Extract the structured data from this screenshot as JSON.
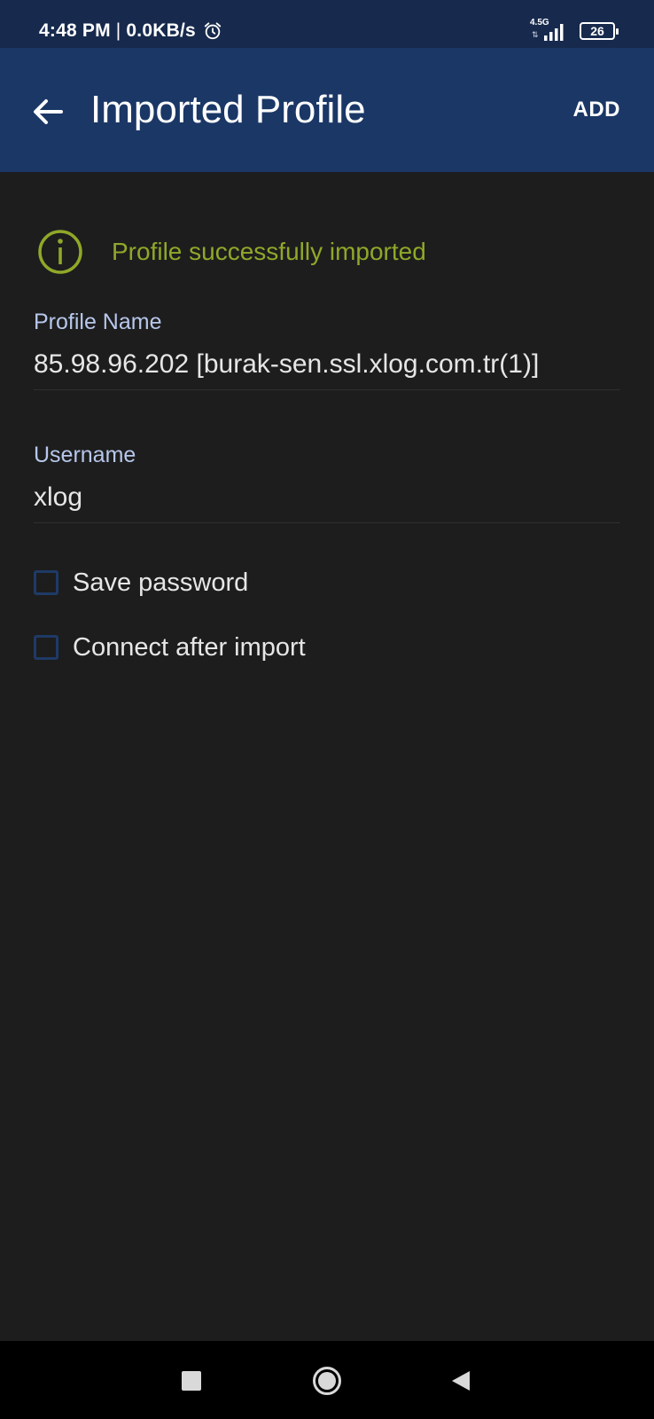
{
  "status_bar": {
    "time": "4:48 PM",
    "separator": "|",
    "speed": "0.0KB/s",
    "network_type": "4.5G",
    "network_arrows": "⇅",
    "battery_level": "26",
    "icons": [
      "alarm-icon",
      "signal-icon",
      "battery-icon"
    ]
  },
  "app_bar": {
    "title": "Imported Profile",
    "action_label": "ADD",
    "icons": [
      "back-arrow-icon"
    ],
    "background_color": "#1a3766"
  },
  "notice": {
    "text": "Profile successfully imported",
    "icon": "info-icon",
    "color": "#8fa829"
  },
  "form": {
    "profile_name": {
      "label": "Profile Name",
      "value": "85.98.96.202 [burak-sen.ssl.xlog.com.tr(1)]"
    },
    "username": {
      "label": "Username",
      "value": "xlog"
    },
    "options": [
      {
        "label": "Save password",
        "checked": false
      },
      {
        "label": "Connect after import",
        "checked": false
      }
    ]
  },
  "nav_bar": {
    "icons": [
      "recents-icon",
      "home-icon",
      "back-icon"
    ]
  }
}
